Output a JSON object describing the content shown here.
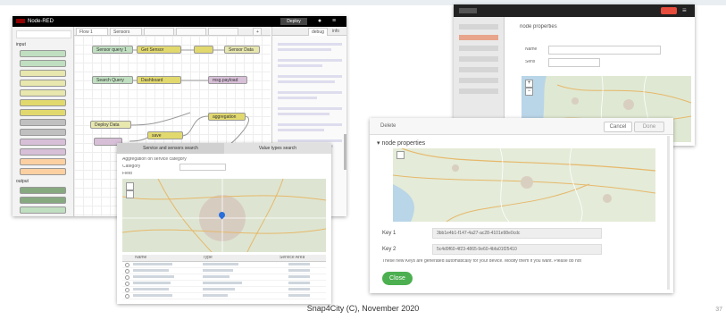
{
  "footer": {
    "text": "Snap4City (C), November 2020",
    "page_number": "37"
  },
  "nodered": {
    "app_title": "Node-RED",
    "deploy_label": "Deploy",
    "palette_categories": [
      "input",
      "output"
    ],
    "tabs": [
      "Flow 1",
      "Sensors"
    ],
    "sidebar_tabs": [
      "debug",
      "info"
    ],
    "flow_nodes": [
      "Sensor query 1",
      "Get Sensor",
      "Sensor Data",
      "Search Query",
      "Dashboard",
      "msg.payload",
      "Deploy Data",
      "aggregation",
      "save"
    ]
  },
  "dashboard_window": {
    "section": "node properties",
    "field_labels": [
      "Name",
      "Sens"
    ],
    "zoom_in": "+",
    "zoom_out": "−"
  },
  "prop_window": {
    "delete_label": "Delete",
    "cancel_label": "Cancel",
    "done_label": "Done",
    "section_title": "node properties",
    "key1_label": "Key 1",
    "key1_value": "3bb1e4b1-f147-4a27-ac28-4101e98e0cdc",
    "key2_label": "Key 2",
    "key2_value": "5c4d9f60-4f23-4865-9e60-4bfa01f25410",
    "note": "These new Keys are generated automatically for your device. Modify them if you want. Please do not",
    "close_label": "Close"
  },
  "sensor_window": {
    "tab1": "Service and sensors search",
    "tab2": "Value types search",
    "filters": [
      "Aggregation on service category",
      "Category",
      "Field"
    ],
    "grid_headers": [
      "Name",
      "Type",
      "Service Area"
    ]
  },
  "colors": {
    "close_button": "#4caf50",
    "map_pin": "#2a6fdb",
    "header_dark": "#000000"
  }
}
